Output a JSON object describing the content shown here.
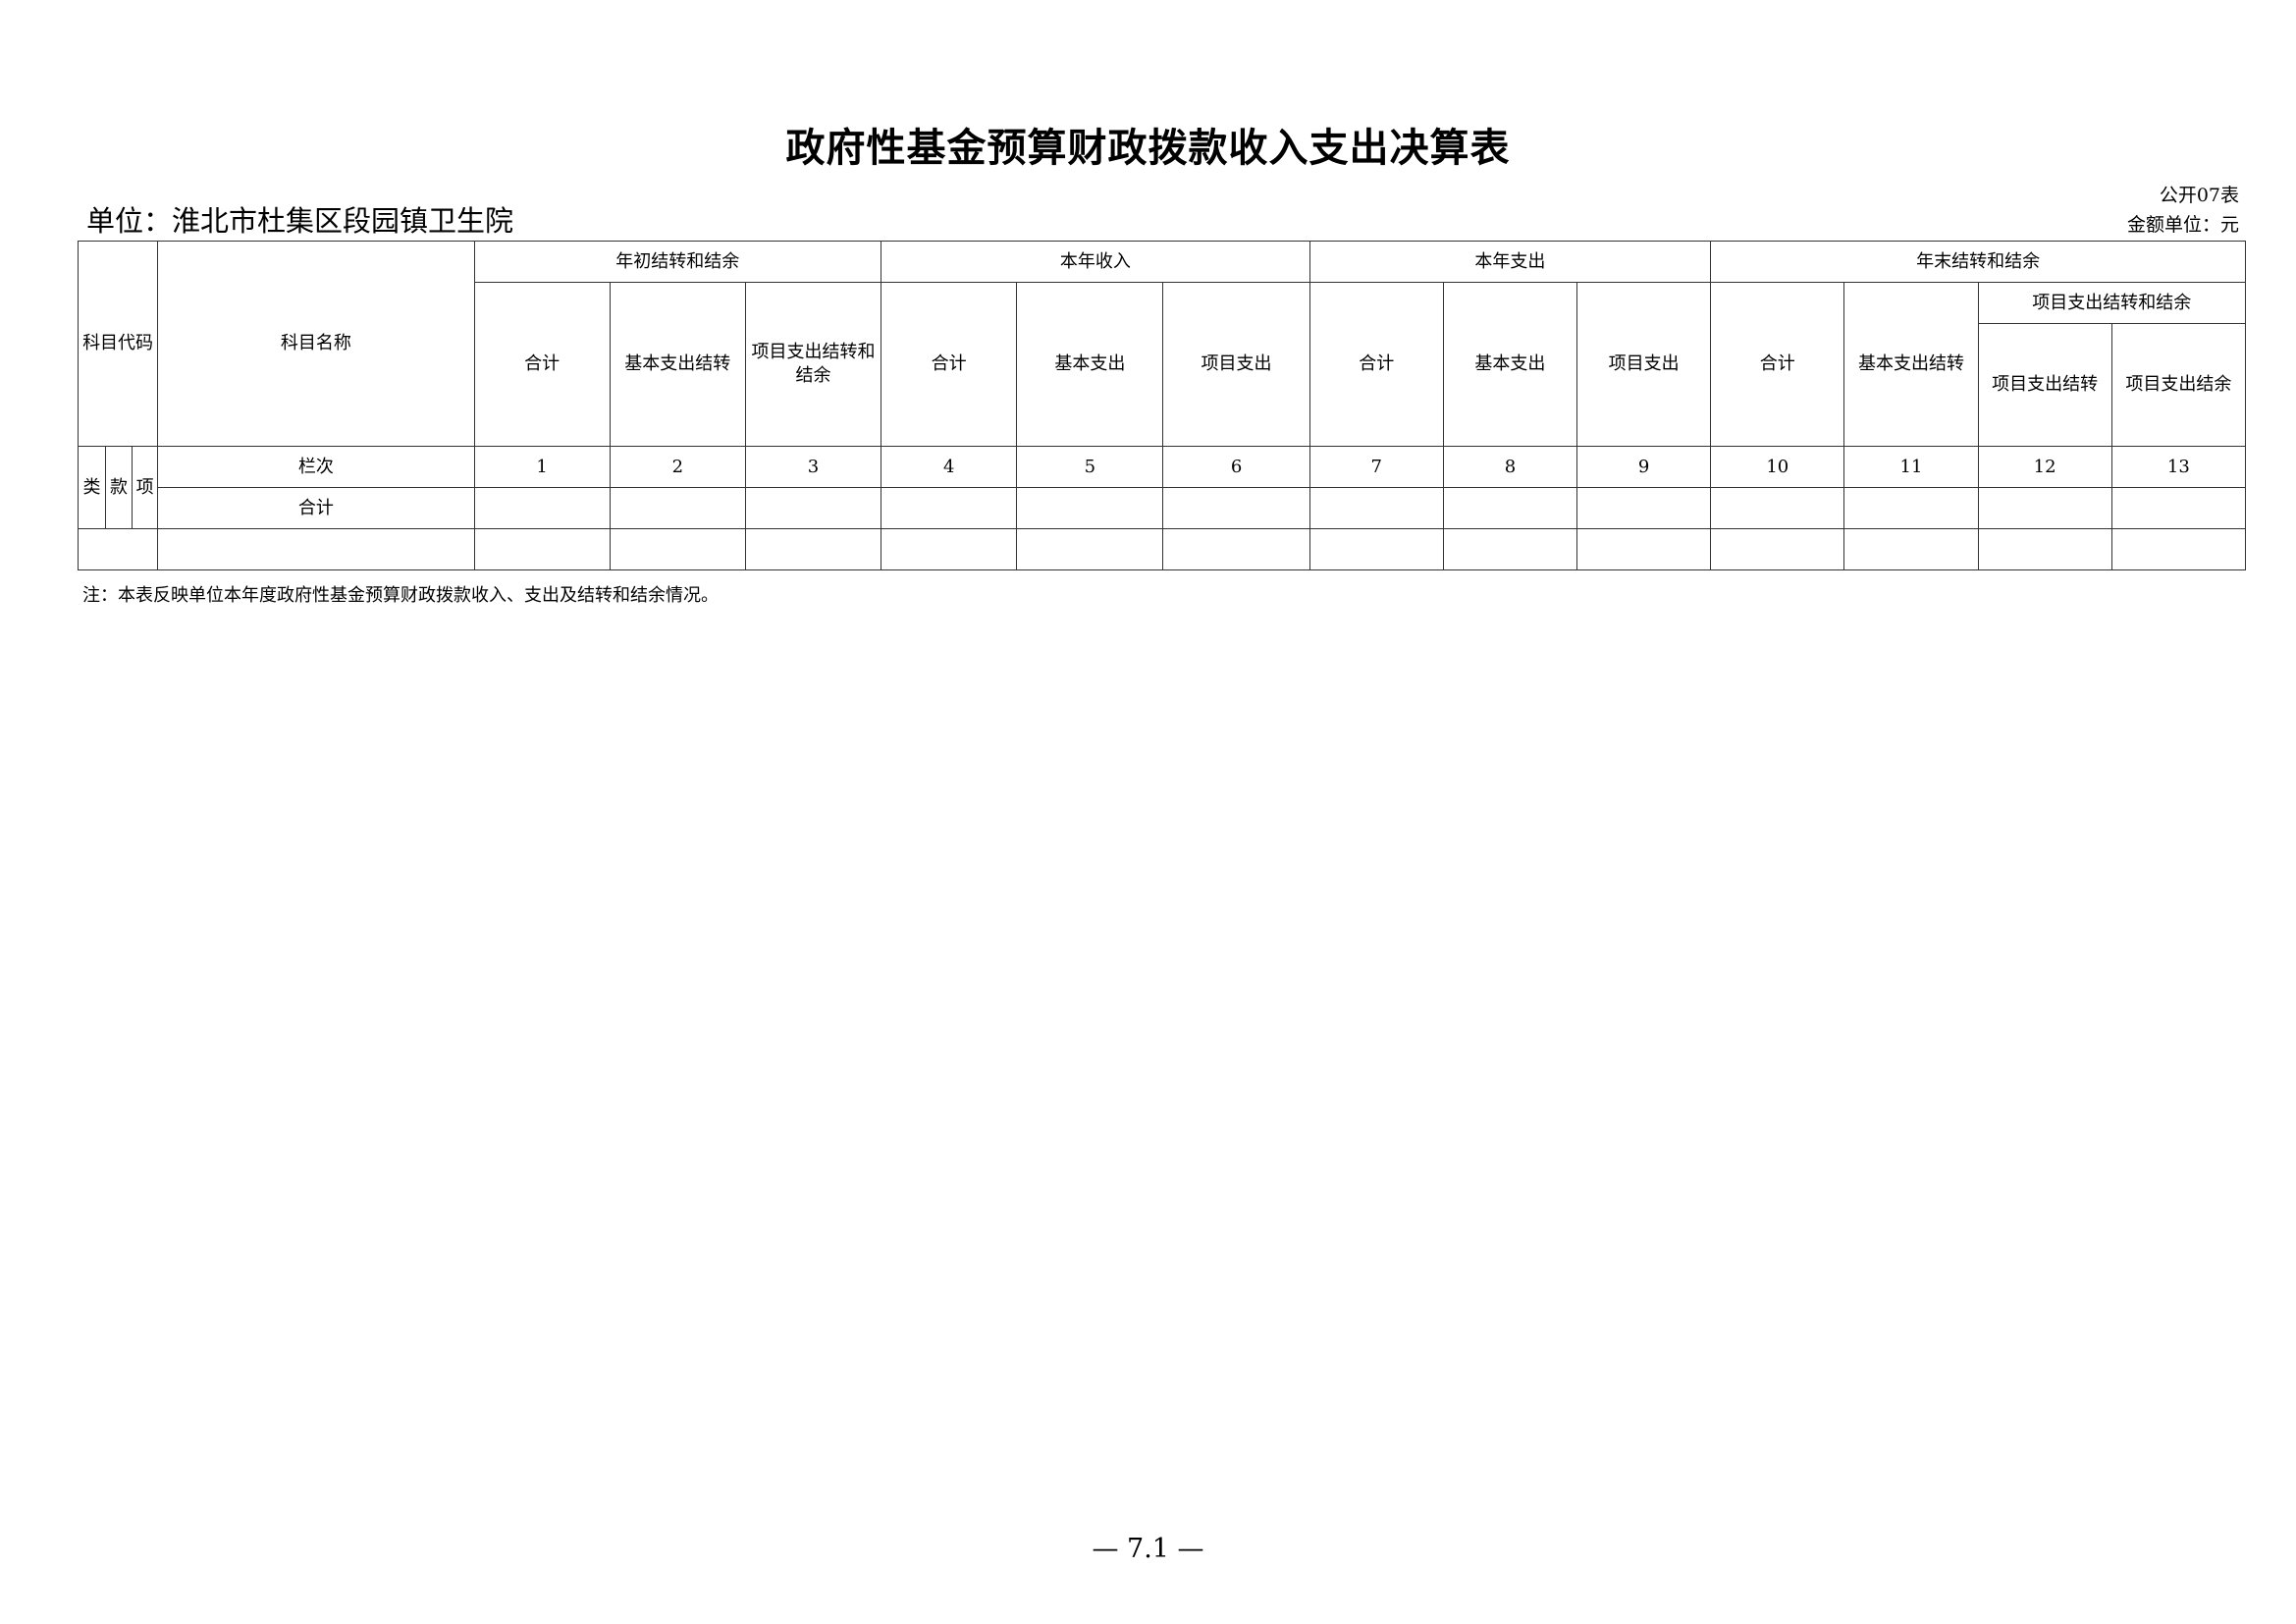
{
  "title": "政府性基金预算财政拨款收入支出决算表",
  "unit": "单位：淮北市杜集区段园镇卫生院",
  "form_no": "公开07表",
  "currency": "金额单位：元",
  "table": {
    "code_header": "科目代码",
    "name_header": "科目名称",
    "groups": {
      "begin": "年初结转和结余",
      "income": "本年收入",
      "expense": "本年支出",
      "end": "年末结转和结余"
    },
    "sub_project_carry": "项目支出结转和结余",
    "cols": {
      "c1": "合计",
      "c2": "基本支出结转",
      "c3": "项目支出结转和结余",
      "c4": "合计",
      "c5": "基本支出",
      "c6": "项目支出",
      "c7": "合计",
      "c8": "基本支出",
      "c9": "项目支出",
      "c10": "合计",
      "c11": "基本支出结转",
      "c12": "项目支出结转",
      "c13": "项目支出结余"
    },
    "code_sub": [
      "类",
      "款",
      "项"
    ],
    "col_index_label": "栏次",
    "col_numbers": [
      "1",
      "2",
      "3",
      "4",
      "5",
      "6",
      "7",
      "8",
      "9",
      "10",
      "11",
      "12",
      "13"
    ],
    "total_label": "合计"
  },
  "note": "注：本表反映单位本年度政府性基金预算财政拨款收入、支出及结转和结余情况。",
  "page_number": "— 7.1 —"
}
